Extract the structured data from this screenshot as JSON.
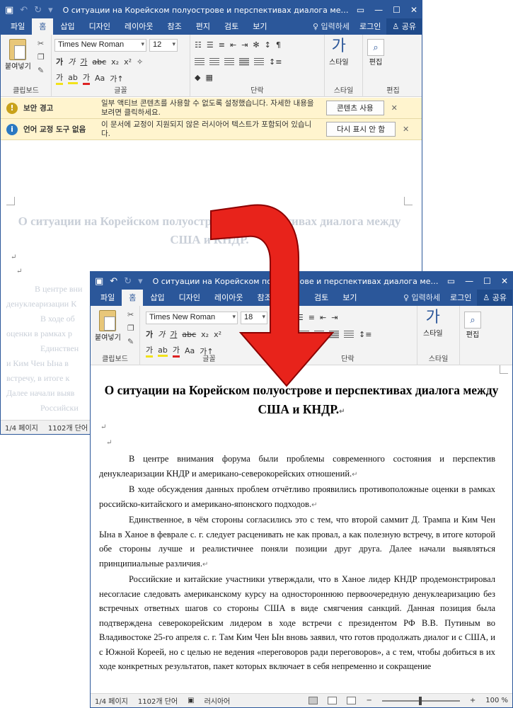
{
  "window_back": {
    "title": "О ситуации на Корейском полуострове и перспективах диалога межд...",
    "tabs": [
      "파일",
      "홈",
      "삽입",
      "디자인",
      "레이아웃",
      "참조",
      "편지",
      "검토",
      "보기"
    ],
    "tell_me": "입력하세",
    "login": "로그인",
    "share": "공유",
    "font_name": "Times New Roman",
    "font_size": "12",
    "paste_label": "붙여넣기",
    "group_labels": [
      "클립보드",
      "글꼴",
      "단락",
      "스타일",
      "편집"
    ],
    "style_label": "스타일",
    "edit_label": "편집",
    "security_bar": {
      "title": "보안 경고",
      "text": "일부 액티브 콘텐츠를 사용할 수 없도록 설정했습니다. 자세한 내용을 보려면 클릭하세요.",
      "button": "콘텐츠 사용"
    },
    "proofing_bar": {
      "title": "언어 교정 도구 없음",
      "text": "이 문서에 교정이 지원되지 않은 러시아어 텍스트가 포함되어 있습니다.",
      "button": "다시 표시 안 함"
    },
    "faded_title": "О ситуации на Корейском полуострове и перспективах диалога между США и КНДР.",
    "faded_lines": [
      "В центре вни",
      "денуклеаризации К",
      "В ходе об",
      "оценки в рамках р",
      "Единствен",
      "и Ким Чен Ына в",
      "встречу, в итоге к",
      "Далее начали выяв",
      "Российски"
    ],
    "status_pages": "1/4 페이지",
    "status_words": "1102개 단어"
  },
  "window_front": {
    "title": "О ситуации на Корейском полуострове и перспективах диалога межд...",
    "tabs": [
      "파일",
      "홈",
      "삽입",
      "디자인",
      "레이아웃",
      "참조",
      "편지",
      "검토",
      "보기"
    ],
    "tell_me": "입력하세",
    "login": "로그인",
    "share": "공유",
    "font_name": "Times New Roman",
    "font_size": "18",
    "paste_label": "붙여넣기",
    "group_labels": [
      "클립보드",
      "글꼴",
      "단락",
      "스타일"
    ],
    "style_label": "스타일",
    "edit_label": "편집",
    "doc_title": "О ситуации на Корейском полуострове и перспективах диалога между США и КНДР.",
    "paragraphs": [
      "В центре внимания форума были проблемы современного состояния и перспектив денуклеаризации КНДР и американо-северокорейских отношений.",
      "В ходе обсуждения данных проблем отчётливо проявились противоположные оценки в рамках российско-китайского и американо-японского подходов.",
      "Единственное, в чём стороны согласились это с тем, что второй саммит Д. Трампа и Ким Чен Ына в Ханое в феврале с. г. следует расценивать не как провал, а как полезную встречу, в итоге которой обе стороны лучше и реалистичнее поняли позиции друг друга. Далее начали выявляться принципиальные различия.",
      "Российские и китайские участники утверждали, что в Ханое лидер КНДР продемонстрировал несогласие следовать американскому курсу на одностороннюю первоочередную денуклеаризацию без встречных ответных шагов со стороны США в виде смягчения санкций. Данная позиция была подтверждена северокорейским лидером в ходе встречи с президентом РФ В.В. Путиным во Владивостоке 25-го апреля с. г. Там Ким Чен Ын вновь заявил, что готов продолжать диалог и с США, и с Южной Кореей, но с целью не ведения «переговоров ради переговоров», а с тем, чтобы добиться в их ходе конкретных результатов, пакет которых включает в себя непременно и сокращение"
    ],
    "status_pages": "1/4 페이지",
    "status_words": "1102개 단어",
    "status_lang": "러시아어",
    "zoom": "100 %"
  },
  "colors": {
    "word_blue": "#2b579a",
    "arrow_red": "#e8231b",
    "arrow_outline": "#8b0000",
    "message_bar": "#fff4ce"
  }
}
